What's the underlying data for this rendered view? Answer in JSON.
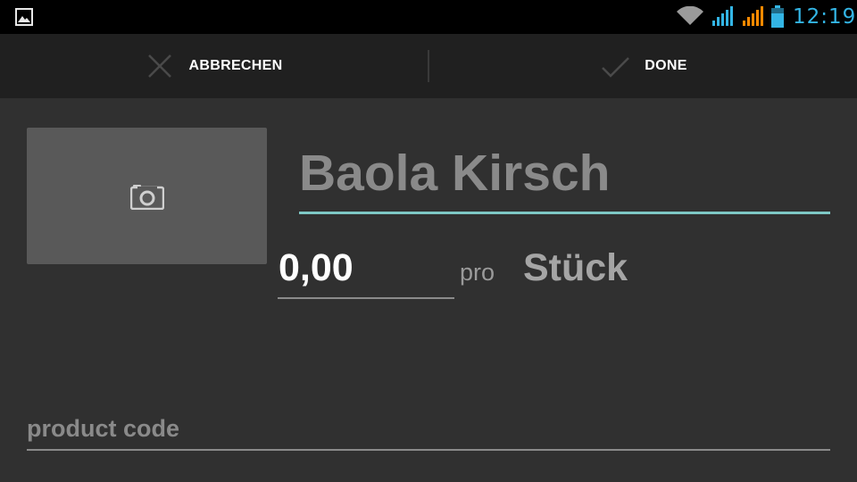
{
  "status_bar": {
    "time": "12:19",
    "icons": [
      "image-notification-icon",
      "wifi-icon",
      "signal-icon",
      "signal-icon",
      "battery-icon"
    ],
    "accent_color": "#33b5e5",
    "secondary_signal_color": "#ff8a00"
  },
  "action_bar": {
    "cancel_label": "ABBRECHEN",
    "cancel_icon": "close-icon",
    "done_label": "DONE",
    "done_icon": "check-icon"
  },
  "form": {
    "photo_icon": "camera-icon",
    "name_value": "Baola Kirsch",
    "price_value": "0,00",
    "per_label": "pro",
    "unit_value": "Stück",
    "product_code_placeholder": "product code"
  },
  "colors": {
    "background": "#303030",
    "action_bar_background": "#202020",
    "focused_underline": "#7ec8c5"
  }
}
